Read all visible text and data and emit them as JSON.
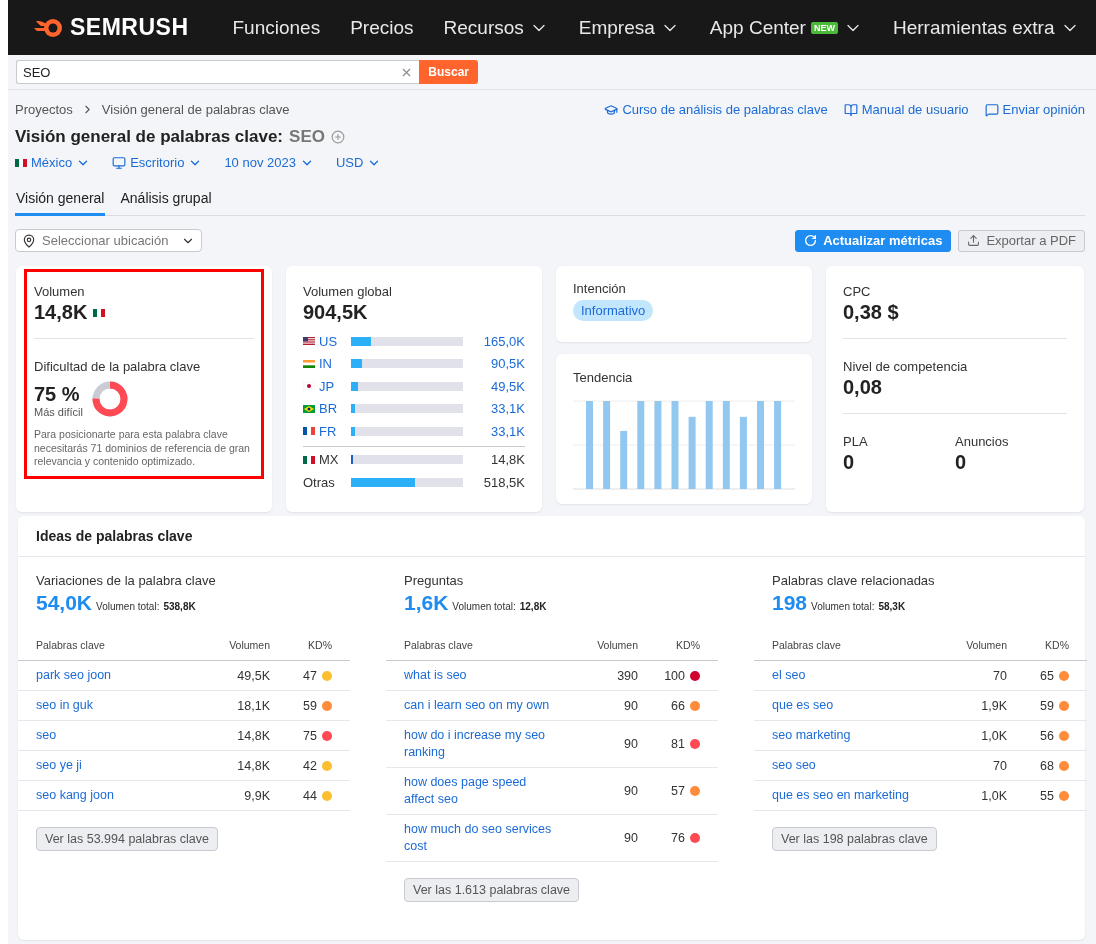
{
  "nav": {
    "logo": "SEMRUSH",
    "items": [
      {
        "label": "Funciones",
        "dropdown": false
      },
      {
        "label": "Precios",
        "dropdown": false
      },
      {
        "label": "Recursos",
        "dropdown": true
      },
      {
        "label": "Empresa",
        "dropdown": true
      },
      {
        "label": "App Center",
        "badge": "NEW",
        "dropdown": true
      },
      {
        "label": "Herramientas extra",
        "dropdown": true
      }
    ]
  },
  "search": {
    "value": "SEO",
    "button": "Buscar"
  },
  "breadcrumb": [
    "Proyectos",
    "Visión general de palabras clave"
  ],
  "header_links": [
    {
      "kind": "course",
      "label": "Curso de análisis de palabras clave"
    },
    {
      "kind": "manual",
      "label": "Manual de usuario"
    },
    {
      "kind": "feedback",
      "label": "Enviar opinión"
    }
  ],
  "title": "Visión general de palabras clave:",
  "keyword": "SEO",
  "filters": [
    {
      "kind": "flag",
      "label": "México"
    },
    {
      "kind": "device",
      "label": "Escritorio"
    },
    {
      "kind": "plain",
      "label": "10 nov 2023"
    },
    {
      "kind": "plain",
      "label": "USD"
    }
  ],
  "tabs": [
    {
      "label": "Visión general",
      "selected": true
    },
    {
      "label": "Análisis grupal",
      "selected": false
    }
  ],
  "location_select": {
    "placeholder": "Seleccionar ubicación"
  },
  "actions": [
    {
      "kind": "primary",
      "label": "Actualizar métricas"
    },
    {
      "kind": "secondary",
      "label": "Exportar a PDF"
    }
  ],
  "volume_card": {
    "highlighted": true,
    "label": "Volumen",
    "value": "14,8K",
    "difficulty_label": "Dificultad de la palabra clave",
    "difficulty_value": "75 %",
    "difficulty_text": "Más difícil",
    "note": "Para posicionarte para esta palabra clave necesitarás 71 dominios de referencia de gran relevancia y contenido optimizado."
  },
  "global_card": {
    "label": "Volumen global",
    "value": "904,5K",
    "countries": [
      {
        "code": "US",
        "kind": "us",
        "level": 0.18,
        "value": "165,0K",
        "link": true
      },
      {
        "code": "IN",
        "kind": "in",
        "level": 0.1,
        "value": "90,5K",
        "link": true
      },
      {
        "code": "JP",
        "kind": "jp",
        "level": 0.06,
        "value": "49,5K",
        "link": true
      },
      {
        "code": "BR",
        "kind": "br",
        "level": 0.04,
        "value": "33,1K",
        "link": true
      },
      {
        "code": "FR",
        "kind": "fr",
        "level": 0.04,
        "value": "33,1K",
        "link": true
      },
      {
        "code": "MX",
        "kind": "mx",
        "level": 0.02,
        "value": "14,8K",
        "link": false
      },
      {
        "code": "Otras",
        "level": 0.57,
        "value": "518,5K",
        "link": false
      }
    ]
  },
  "intent_card": {
    "label": "Intención",
    "tag": "Informativo"
  },
  "trend_card": {
    "label": "Tendencia"
  },
  "cpc_card": {
    "cpc_label": "CPC",
    "cpc": "0,38 $",
    "competition_label": "Nivel de competencia",
    "competition": "0,08",
    "pla_label": "PLA",
    "pla": "0",
    "ads_label": "Anuncios",
    "ads": "0"
  },
  "ideas": {
    "title": "Ideas de palabras clave",
    "groups": [
      {
        "title": "Variaciones de la palabra clave",
        "count": "54,0K",
        "total_label": "Volumen total:",
        "total": "538,8K",
        "columns": [
          "Palabras clave",
          "Volumen",
          "KD%"
        ],
        "button": "Ver las 53.994 palabras clave",
        "rows": [
          {
            "keyword": "park seo joon",
            "volume": "49,5K",
            "kd": "47",
            "color": "#fcc02e"
          },
          {
            "keyword": "seo in guk",
            "volume": "18,1K",
            "kd": "59",
            "color": "#ff8c3a"
          },
          {
            "keyword": "seo",
            "volume": "14,8K",
            "kd": "75",
            "color": "#ff4953"
          },
          {
            "keyword": "seo ye ji",
            "volume": "14,8K",
            "kd": "42",
            "color": "#fcc02e"
          },
          {
            "keyword": "seo kang joon",
            "volume": "9,9K",
            "kd": "44",
            "color": "#fcc02e"
          }
        ]
      },
      {
        "title": "Preguntas",
        "count": "1,6K",
        "total_label": "Volumen total:",
        "total": "12,8K",
        "columns": [
          "Palabras clave",
          "Volumen",
          "KD%"
        ],
        "button": "Ver las 1.613 palabras clave",
        "rows": [
          {
            "keyword": "what is seo",
            "volume": "390",
            "kd": "100",
            "color": "#d1002f"
          },
          {
            "keyword": "can i learn seo on my own",
            "volume": "90",
            "kd": "66",
            "color": "#ff8c3a"
          },
          {
            "keyword": "how do i increase my seo ranking",
            "volume": "90",
            "kd": "81",
            "color": "#ff4953"
          },
          {
            "keyword": "how does page speed affect seo",
            "volume": "90",
            "kd": "57",
            "color": "#ff8c3a"
          },
          {
            "keyword": "how much do seo services cost",
            "volume": "90",
            "kd": "76",
            "color": "#ff4953"
          }
        ]
      },
      {
        "title": "Palabras clave relacionadas",
        "count": "198",
        "total_label": "Volumen total:",
        "total": "58,3K",
        "columns": [
          "Palabras clave",
          "Volumen",
          "KD%"
        ],
        "button": "Ver las 198 palabras clave",
        "rows": [
          {
            "keyword": "el seo",
            "volume": "70",
            "kd": "65",
            "color": "#ff8c3a"
          },
          {
            "keyword": "que es seo",
            "volume": "1,9K",
            "kd": "59",
            "color": "#ff8c3a"
          },
          {
            "keyword": "seo marketing",
            "volume": "1,0K",
            "kd": "56",
            "color": "#ff8c3a"
          },
          {
            "keyword": "seo seo",
            "volume": "70",
            "kd": "68",
            "color": "#ff8c3a"
          },
          {
            "keyword": "que es seo en marketing",
            "volume": "1,0K",
            "kd": "55",
            "color": "#ff8c3a"
          }
        ]
      }
    ]
  }
}
